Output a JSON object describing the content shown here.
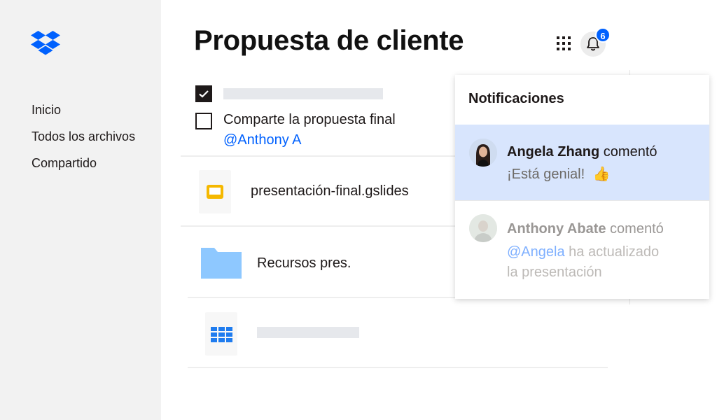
{
  "sidebar": {
    "logo_icon": "dropbox-logo-icon",
    "nav": [
      {
        "label": "Inicio"
      },
      {
        "label": "Todos los archivos"
      },
      {
        "label": "Compartido"
      }
    ]
  },
  "header": {
    "title": "Propuesta de cliente",
    "apps_icon": "grid-apps-icon",
    "bell_icon": "bell-icon",
    "notification_count": "6"
  },
  "tasks": [
    {
      "checked": true,
      "text": ""
    },
    {
      "checked": false,
      "text": "Comparte la propuesta final",
      "mention": "@Anthony A"
    }
  ],
  "files": [
    {
      "name": "presentación-final.gslides",
      "icon": "google-slides-icon"
    },
    {
      "name": "Recursos pres.",
      "icon": "folder-icon"
    },
    {
      "name": "",
      "icon": "spreadsheet-icon"
    }
  ],
  "notifications": {
    "title": "Notificaciones",
    "items": [
      {
        "author": "Angela Zhang",
        "action": "comentó",
        "message": "¡Está genial!",
        "emoji": "👍"
      },
      {
        "author": "Anthony Abate",
        "action": "comentó",
        "mention": "@Angela",
        "message_line1": "ha actualizado",
        "message_line2": "la presentación"
      }
    ]
  },
  "colors": {
    "accent": "#0061fe",
    "sidebar_bg": "#f2f2f2",
    "highlight": "#d8e5fd",
    "folder": "#8ec8ff"
  }
}
